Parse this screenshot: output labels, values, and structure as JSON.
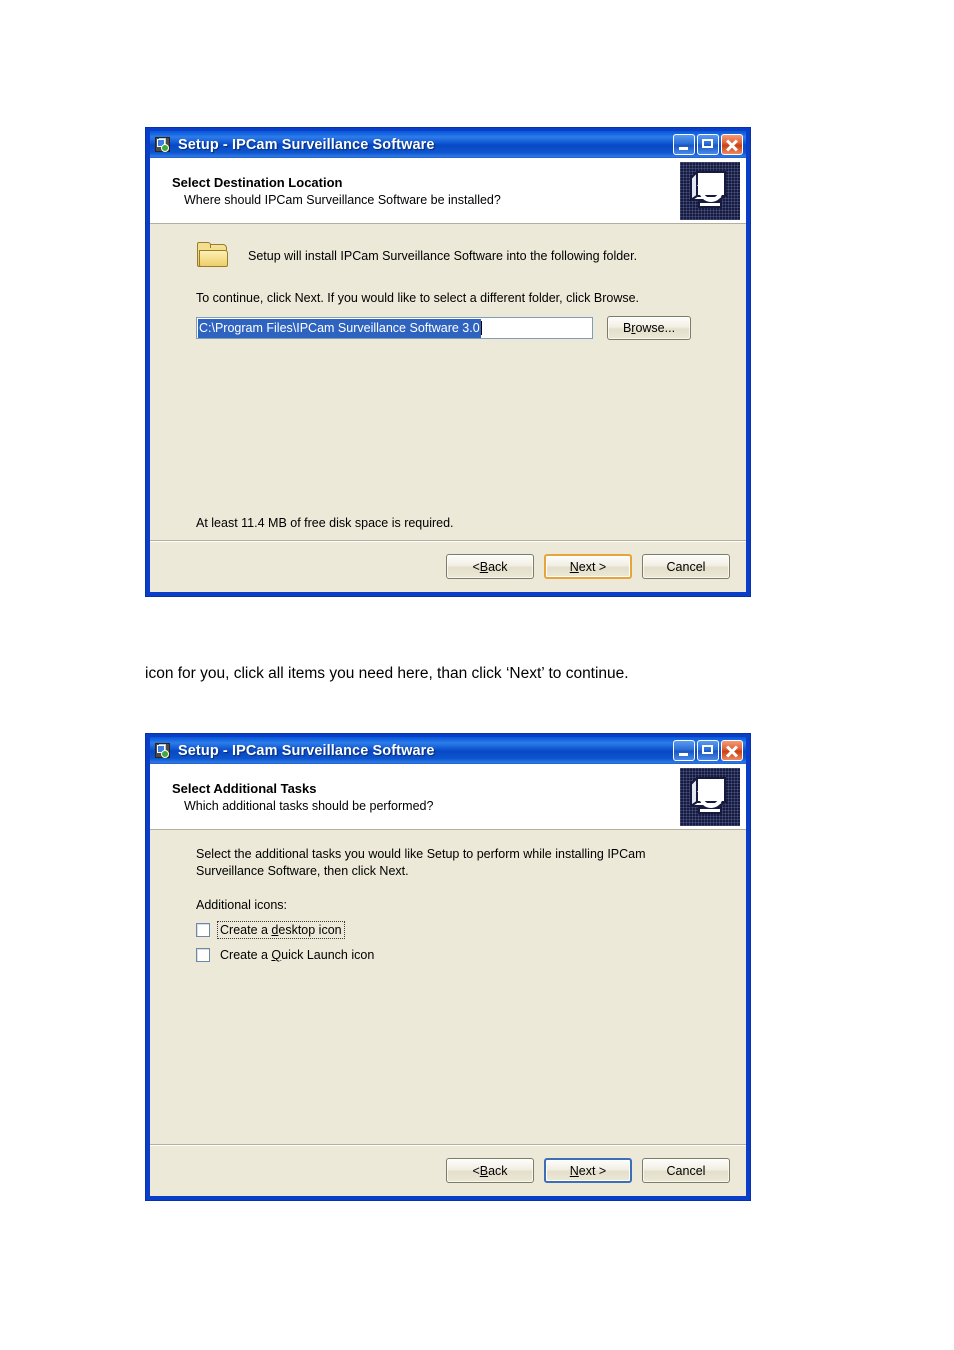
{
  "document": {
    "caption_text": "icon for you, click all items you need here, than click ‘Next’ to continue."
  },
  "dialog1": {
    "titlebar": {
      "title": "Setup - IPCam Surveillance Software",
      "minimize_label": "Minimize",
      "maximize_label": "Maximize",
      "close_label": "Close"
    },
    "header": {
      "title": "Select Destination Location",
      "subtitle": "Where should IPCam Surveillance Software be installed?"
    },
    "body": {
      "folder_line": "Setup will install IPCam Surveillance Software into the following folder.",
      "continue_line": "To continue, click Next. If you would like to select a different folder, click Browse.",
      "path_value": "C:\\Program Files\\IPCam Surveillance Software 3.0",
      "path_placeholder": "C:\\Program Files\\",
      "browse_label_pre": "B",
      "browse_label_accel": "r",
      "browse_label_post": "owse...",
      "disk_note": "At least 11.4 MB of free disk space is required."
    },
    "buttons": {
      "back_pre": "< ",
      "back_accel": "B",
      "back_post": "ack",
      "next_pre": "",
      "next_accel": "N",
      "next_post": "ext >",
      "cancel": "Cancel",
      "focused": "next"
    }
  },
  "dialog2": {
    "titlebar": {
      "title": "Setup - IPCam Surveillance Software",
      "minimize_label": "Minimize",
      "maximize_label": "Maximize",
      "close_label": "Close"
    },
    "header": {
      "title": "Select Additional Tasks",
      "subtitle": "Which additional tasks should be performed?"
    },
    "body": {
      "intro": "Select the additional tasks you would like Setup to perform while installing IPCam Surveillance Software, then click Next.",
      "group_label": "Additional icons:",
      "checkboxes": [
        {
          "label_pre": "Create a ",
          "label_accel": "d",
          "label_post": "esktop icon",
          "checked": false,
          "focused": true
        },
        {
          "label_pre": "Create a ",
          "label_accel": "Q",
          "label_post": "uick Launch icon",
          "checked": false,
          "focused": false
        }
      ]
    },
    "buttons": {
      "back_pre": "< ",
      "back_accel": "B",
      "back_post": "ack",
      "next_pre": "",
      "next_accel": "N",
      "next_post": "ext >",
      "cancel": "Cancel",
      "focused": "next"
    }
  },
  "colors": {
    "titlebar_blue": "#0a56d6",
    "window_frame": "#0a3dc8",
    "dialog_face": "#ece9d8",
    "selection_blue": "#2f63c0",
    "focus_orange": "#e8a33d",
    "banner_navy": "#161b3d"
  }
}
